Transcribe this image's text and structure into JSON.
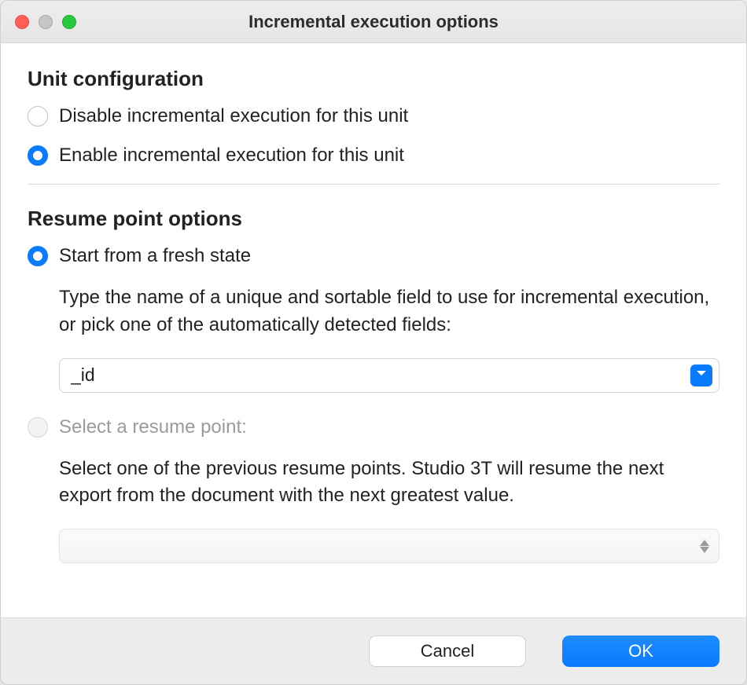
{
  "window": {
    "title": "Incremental execution options"
  },
  "unitConfig": {
    "heading": "Unit configuration",
    "disable_label": "Disable incremental execution for this unit",
    "enable_label": "Enable incremental execution for this unit"
  },
  "resume": {
    "heading": "Resume point options",
    "fresh_label": "Start from a fresh state",
    "fresh_description": "Type the name of a unique and sortable field to use for incremental execution, or pick one of the automatically detected fields:",
    "field_value": "_id",
    "select_label": "Select a resume point:",
    "select_description": "Select one of the previous resume points. Studio 3T will resume the next export from the document with the next greatest value."
  },
  "footer": {
    "cancel_label": "Cancel",
    "ok_label": "OK"
  }
}
